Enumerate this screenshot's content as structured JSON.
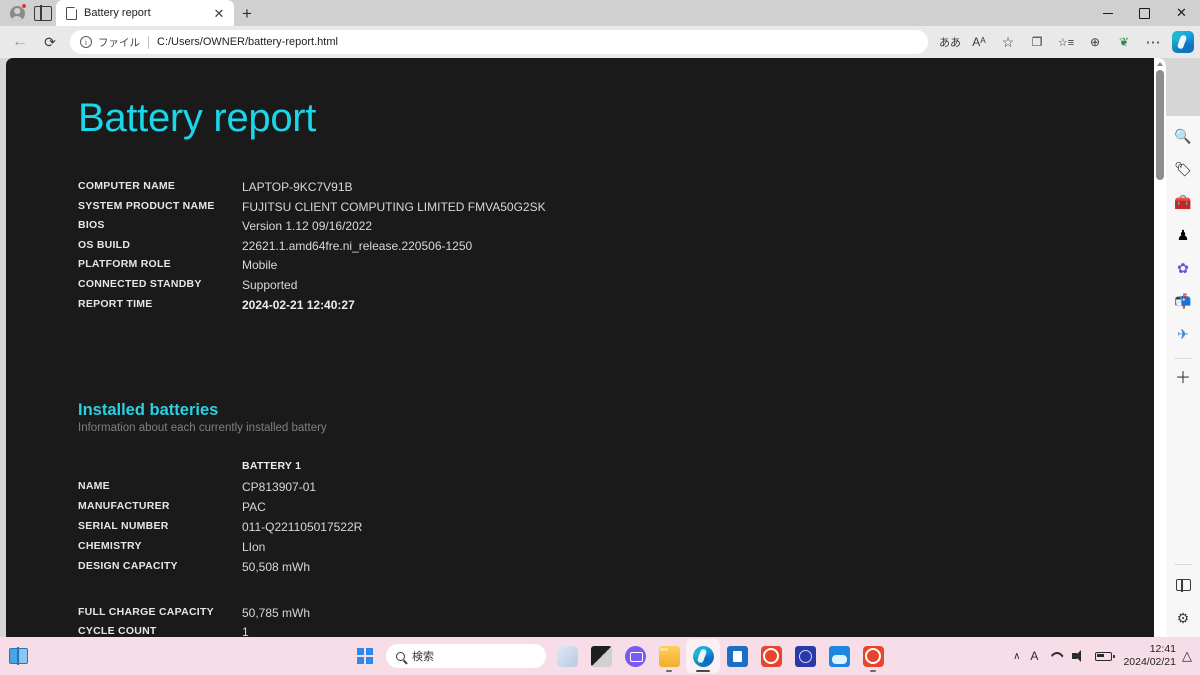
{
  "browser": {
    "tab": {
      "title": "Battery report",
      "close_label": "✕",
      "favicon": "page-icon"
    },
    "new_tab_label": "+",
    "window_controls": {
      "minimize": "–",
      "maximize": "□",
      "close": "✕"
    },
    "nav": {
      "back": "←",
      "reload": "⟳",
      "scheme_label": "ファイル",
      "separator": "|",
      "url": "C:/Users/OWNER/battery-report.html",
      "info_icon_glyph": "i"
    },
    "toolbar_right": [
      {
        "name": "read-aloud-icon",
        "glyph": "ああ"
      },
      {
        "name": "immersive-reader-icon",
        "glyph": "Aᴬ"
      },
      {
        "name": "favorite-star-icon",
        "glyph": "☆"
      },
      {
        "name": "collections-icon",
        "glyph": "❐"
      },
      {
        "name": "favorites-list-icon",
        "glyph": "☆≡"
      },
      {
        "name": "browser-essentials-icon",
        "glyph": "⊕"
      },
      {
        "name": "extensions-icon",
        "glyph": "❦"
      },
      {
        "name": "settings-more-icon",
        "glyph": "⋯"
      },
      {
        "name": "copilot-icon",
        "glyph": ""
      }
    ]
  },
  "sidebar": {
    "items": [
      {
        "name": "search-icon",
        "glyph": "🔍"
      },
      {
        "name": "shopping-tag-icon",
        "glyph": "🏷"
      },
      {
        "name": "tools-briefcase-icon",
        "glyph": "🧰"
      },
      {
        "name": "games-icon",
        "glyph": "♟"
      },
      {
        "name": "microsoft-365-icon",
        "glyph": "✿"
      },
      {
        "name": "outlook-icon",
        "glyph": "📬"
      },
      {
        "name": "send-plane-icon",
        "glyph": "✈"
      },
      {
        "name": "add-sidebar-app-icon",
        "glyph": "＋"
      }
    ],
    "bottom": [
      {
        "name": "split-screen-icon",
        "glyph": ""
      },
      {
        "name": "sidebar-settings-icon",
        "glyph": "⚙"
      }
    ]
  },
  "report": {
    "title": "Battery report",
    "system_info": [
      {
        "key": "COMPUTER NAME",
        "value": "LAPTOP-9KC7V91B",
        "strong": false
      },
      {
        "key": "SYSTEM PRODUCT NAME",
        "value": "FUJITSU CLIENT COMPUTING LIMITED FMVA50G2SK",
        "strong": false
      },
      {
        "key": "BIOS",
        "value": "Version 1.12 09/16/2022",
        "strong": false
      },
      {
        "key": "OS BUILD",
        "value": "22621.1.amd64fre.ni_release.220506-1250",
        "strong": false
      },
      {
        "key": "PLATFORM ROLE",
        "value": "Mobile",
        "strong": false
      },
      {
        "key": "CONNECTED STANDBY",
        "value": "Supported",
        "strong": false
      },
      {
        "key": "REPORT TIME",
        "value": "2024-02-21  12:40:27",
        "strong": true
      }
    ],
    "installed_batteries": {
      "heading": "Installed batteries",
      "subheading": "Information about each currently installed battery",
      "column_header": "BATTERY 1",
      "rows": [
        {
          "key": "NAME",
          "value": "CP813907-01"
        },
        {
          "key": "MANUFACTURER",
          "value": "PAC"
        },
        {
          "key": "SERIAL NUMBER",
          "value": "011-Q221105017522R"
        },
        {
          "key": "CHEMISTRY",
          "value": "LIon"
        },
        {
          "key": "DESIGN CAPACITY",
          "value": "50,508 mWh"
        }
      ],
      "rows2": [
        {
          "key": "FULL CHARGE CAPACITY",
          "value": "50,785 mWh"
        },
        {
          "key": "CYCLE COUNT",
          "value": "1"
        }
      ]
    },
    "colors": {
      "title": "#1ad6e8",
      "section": "#2ecfe0",
      "background": "#1a1a1a"
    }
  },
  "taskbar": {
    "widgets_icon": "widgets-icon",
    "start_icon": "windows-start-icon",
    "search_placeholder": "検索",
    "apps": [
      {
        "name": "taskbar-copilot-icon"
      },
      {
        "name": "taskbar-task-view-icon"
      },
      {
        "name": "taskbar-chat-icon"
      },
      {
        "name": "taskbar-file-explorer-icon"
      },
      {
        "name": "taskbar-edge-icon"
      },
      {
        "name": "taskbar-microsoft-store-icon"
      },
      {
        "name": "taskbar-orange-app-icon"
      },
      {
        "name": "taskbar-blue-app-icon"
      },
      {
        "name": "taskbar-photos-icon"
      },
      {
        "name": "taskbar-orange-app2-icon"
      }
    ],
    "tray": {
      "chevron": "∧",
      "ime": "A",
      "wifi_icon": "wifi-icon",
      "volume_icon": "volume-icon",
      "battery_icon": "battery-icon",
      "time": "12:41",
      "date": "2024/02/21",
      "bell": "△"
    }
  }
}
